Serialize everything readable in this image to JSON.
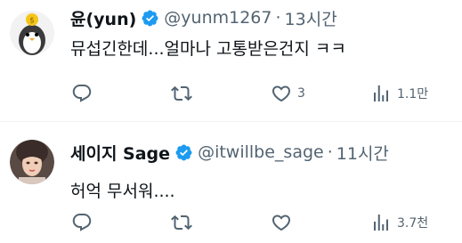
{
  "tweets": [
    {
      "name": "윤(yun)",
      "handle": "@yunm1267",
      "time": "13시간",
      "text": "뮤섭긴한데...얼마나 고통받은건지 ㅋㅋ",
      "reply_count": "",
      "retweet_count": "",
      "like_count": "3",
      "view_count": "1.1만",
      "avatar_icon": "penguin-coin-avatar"
    },
    {
      "name": "세이지 Sage",
      "handle": "@itwillbe_sage",
      "time": "11시간",
      "text": "허억 무서워....",
      "reply_count": "",
      "retweet_count": "",
      "like_count": "",
      "view_count": "3.7천",
      "avatar_icon": "profile-photo-avatar"
    }
  ],
  "separator": "·",
  "colors": {
    "text_primary": "#0f1419",
    "text_secondary": "#536471",
    "verified_blue": "#1d9bf0",
    "divider": "#eff3f4"
  },
  "icons": [
    "reply-icon",
    "retweet-icon",
    "like-icon",
    "views-icon",
    "verified-badge-icon"
  ]
}
